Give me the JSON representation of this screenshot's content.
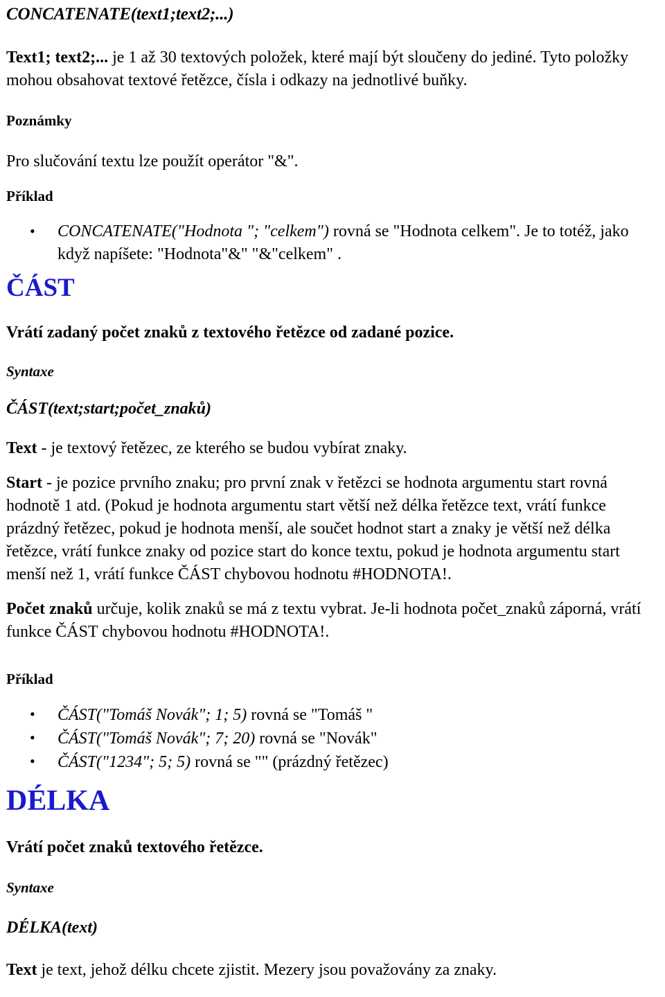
{
  "colors": {
    "heading_blue": "#1a1acc",
    "body_text": "#000000",
    "page_background": "#ffffff"
  },
  "concatenate": {
    "signature_title": "CONCATENATE(text1;text2;...)",
    "arg_text1_label": "Text1; text2;...",
    "arg_text1_desc": " je 1 až 30 textových položek, které mají být sloučeny do jediné. Tyto položky mohou obsahovat textové řetězce, čísla i odkazy na jednotlivé buňky.",
    "notes_label": "Poznámky",
    "notes_text": "Pro slučování textu lze použít operátor \"&\".",
    "example_label": "Příklad",
    "examples": [
      {
        "formula": "CONCATENATE(\"Hodnota \"; \"celkem\")",
        "result": " rovná se \"Hodnota celkem\". Je to totéž, jako když napíšete: \"Hodnota\"&\" \"&\"celkem\" ."
      }
    ]
  },
  "cast": {
    "heading": "ČÁST",
    "summary": "Vrátí zadaný počet znaků z textového řetězce od zadané pozice.",
    "syntax_label": "Syntaxe",
    "syntax": "ČÁST(text;start;počet_znaků)",
    "arg_text_label": "Text",
    "arg_text_desc": " - je textový řetězec, ze kterého se budou vybírat znaky.",
    "arg_start_label": "Start",
    "arg_start_desc": " - je pozice prvního znaku; pro první znak v řetězci se hodnota argumentu start rovná hodnotě 1 atd. (Pokud je hodnota argumentu start větší než délka řetězce text, vrátí funkce prázdný řetězec, pokud je hodnota menší, ale součet hodnot start a znaky je větší než délka řetězce, vrátí funkce znaky od pozice start do konce textu, pokud je hodnota argumentu start menší než 1, vrátí funkce ČÁST chybovou hodnotu #HODNOTA!.",
    "arg_count_label": "Počet znaků",
    "arg_count_desc": " určuje, kolik znaků se má z textu vybrat. Je-li hodnota počet_znaků záporná, vrátí funkce ČÁST chybovou hodnotu #HODNOTA!.",
    "example_label": "Příklad",
    "examples": [
      {
        "formula": "ČÁST(\"Tomáš Novák\"; 1; 5)",
        "result": " rovná se \"Tomáš \""
      },
      {
        "formula": "ČÁST(\"Tomáš Novák\"; 7; 20)",
        "result": " rovná se \"Novák\""
      },
      {
        "formula": "ČÁST(\"1234\"; 5; 5)",
        "result": " rovná se \"\" (prázdný řetězec)"
      }
    ]
  },
  "delka": {
    "heading": "DÉLKA",
    "summary": "Vrátí počet znaků textového řetězce.",
    "syntax_label": "Syntaxe",
    "syntax": "DÉLKA(text)",
    "arg_text_label": "Text",
    "arg_text_desc": " je text, jehož délku chcete zjistit. Mezery jsou považovány za znaky."
  }
}
